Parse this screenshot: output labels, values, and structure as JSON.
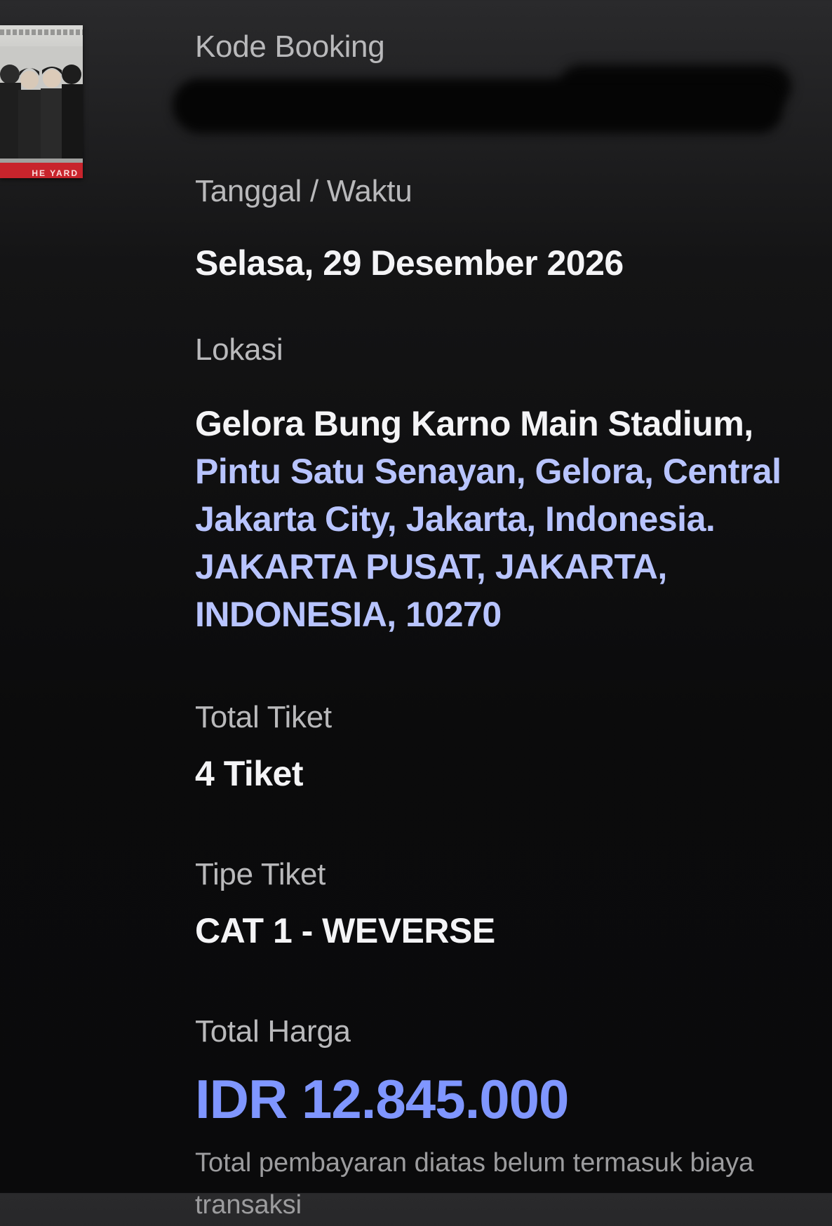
{
  "thumbnail": {
    "banner_text": "HE YARD"
  },
  "booking": {
    "code_label": "Kode Booking"
  },
  "datetime": {
    "label": "Tanggal / Waktu",
    "value": "Selasa, 29 Desember 2026"
  },
  "location": {
    "label": "Lokasi",
    "lines": [
      "Gelora Bung Karno Main Stadium,",
      "Pintu Satu Senayan, Gelora, Central",
      "Jakarta City, Jakarta, Indonesia.",
      "JAKARTA PUSAT, JAKARTA,",
      "INDONESIA, 10270"
    ]
  },
  "tickets": {
    "total_label": "Total Tiket",
    "total_value": "4 Tiket",
    "type_label": "Tipe Tiket",
    "type_value": "CAT 1 - WEVERSE"
  },
  "price": {
    "label": "Total Harga",
    "value": "IDR 12.845.000",
    "note": "Total pembayaran diatas belum termasuk biaya transaksi"
  },
  "colors": {
    "background": "#0b0b0c",
    "label_gray": "#b9b9bb",
    "value_white": "#f4f4f6",
    "address_link": "#b8c4ff",
    "price_blue": "#7f96ff",
    "banner_red": "#c8242c"
  }
}
